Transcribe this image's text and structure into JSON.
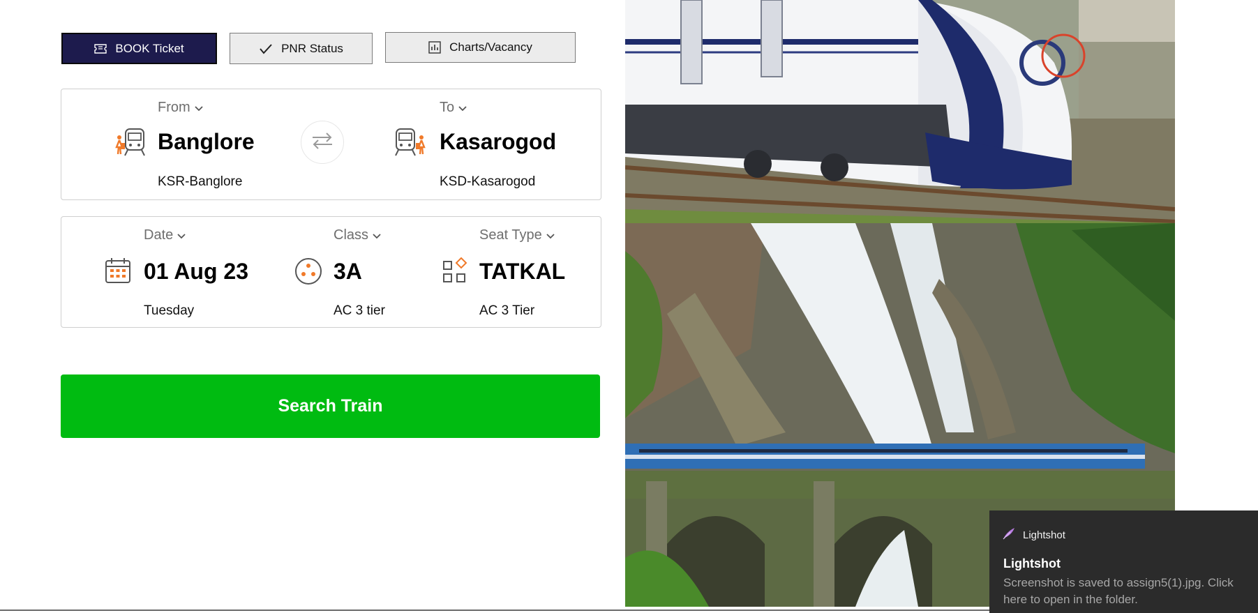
{
  "tabs": {
    "book": "BOOK Ticket",
    "pnr": "PNR Status",
    "charts": "Charts/Vacancy"
  },
  "route": {
    "from": {
      "label": "From",
      "name": "Banglore",
      "code": "KSR-Banglore"
    },
    "to": {
      "label": "To",
      "name": "Kasarogod",
      "code": "KSD-Kasarogod"
    }
  },
  "journey": {
    "date": {
      "label": "Date",
      "value": "01 Aug 23",
      "sub": "Tuesday"
    },
    "class": {
      "label": "Class",
      "value": "3A",
      "sub": "AC 3 tier"
    },
    "seat_type": {
      "label": "Seat Type",
      "value": "TATKAL",
      "sub": "AC 3 Tier"
    }
  },
  "search_button": "Search Train",
  "toast": {
    "app_name": "Lightshot",
    "title": "Lightshot",
    "message": "Screenshot is saved to assign5(1).jpg. Click here to open in the folder."
  },
  "colors": {
    "tab_active": "#1d1b4d",
    "search_green": "#00bb11",
    "icon_orange": "#f07a2a",
    "toast_bg": "#2b2b2b"
  },
  "icons": [
    "ticket-icon",
    "checkmark-icon",
    "bar-chart-icon",
    "train-passenger-icon",
    "swap-arrows-icon",
    "calendar-icon",
    "seat-class-icon",
    "grid-diamond-icon",
    "chevron-down-icon",
    "lightshot-feather-icon"
  ]
}
